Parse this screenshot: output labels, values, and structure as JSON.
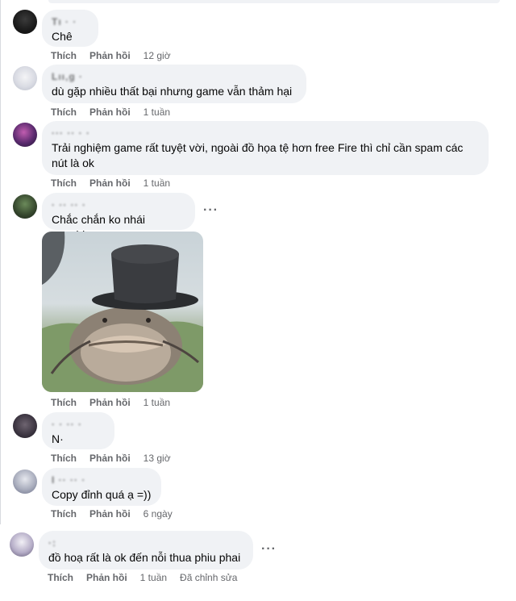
{
  "actions": {
    "like": "Thích",
    "reply": "Phản hồi",
    "edited": "Đã chỉnh sửa"
  },
  "comments": [
    {
      "name": "Tı  ·  ·",
      "text": "Chê",
      "time": "12 giờ"
    },
    {
      "name": "Lıı,g  ·",
      "text": "dù gặp nhiều thất bại nhưng game vẫn thảm hại",
      "time": "1 tuần"
    },
    {
      "name": "··· ··  ·  ·",
      "text": "Trải nghiệm game rất tuyệt vời, ngoài đồ họa tệ hơn free Fire thì chỉ cần spam các nút là ok",
      "time": "1 tuần"
    },
    {
      "name": "·  ·· ·· ·",
      "text": "Chắc chắn ko nhái genshin",
      "time": "1 tuần"
    },
    {
      "name": "·  ·  ·· ·",
      "text": "N·",
      "time": "13 giờ"
    },
    {
      "name": "I ·· ·· ·",
      "text": "Copy đỉnh quá ạ =))",
      "time": "6 ngày"
    },
    {
      "name": "·:",
      "text": "đồ hoạ rất là ok đến nỗi thua phiu phai",
      "time": "1 tuần"
    }
  ],
  "colors": {
    "bubble": "#f0f2f5",
    "meta": "#65676b",
    "text": "#050505"
  },
  "icons": {
    "more": "more-horizontal-icon",
    "photo": "catfish-top-hat-image"
  }
}
